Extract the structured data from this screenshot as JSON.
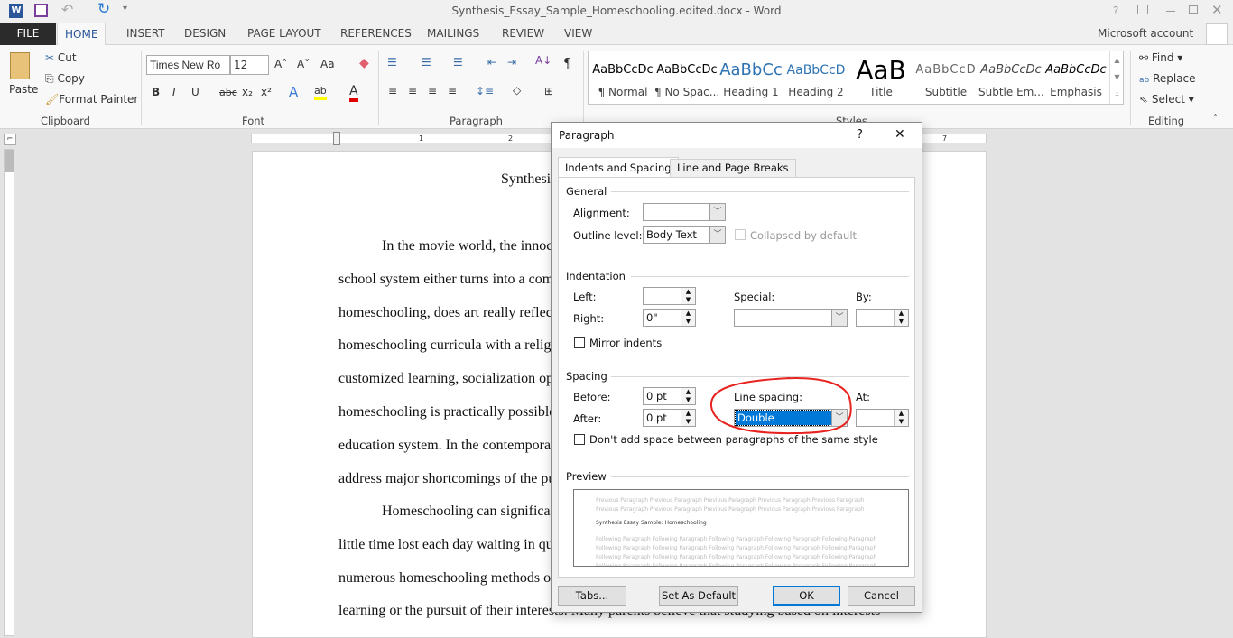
{
  "app": {
    "title": "Synthesis_Essay_Sample_Homeschooling.edited.docx - Word",
    "account": "Microsoft account",
    "help": "?"
  },
  "tabs": [
    "FILE",
    "HOME",
    "INSERT",
    "DESIGN",
    "PAGE LAYOUT",
    "REFERENCES",
    "MAILINGS",
    "REVIEW",
    "VIEW"
  ],
  "clipboard": {
    "paste": "Paste",
    "cut": "Cut",
    "copy": "Copy",
    "format_painter": "Format Painter",
    "label": "Clipboard"
  },
  "font": {
    "name": "Times New Ro",
    "size": "12",
    "label": "Font",
    "bold": "B",
    "italic": "I",
    "underline": "U",
    "strike": "abc",
    "sub": "x₂",
    "sup": "x²",
    "grow": "A˄",
    "shrink": "A˅",
    "case": "Aa"
  },
  "paragraph": {
    "label": "Paragraph",
    "pilcrow": "¶"
  },
  "styles": {
    "label": "Styles",
    "items": [
      {
        "preview": "AaBbCcDc",
        "name": "¶ Normal"
      },
      {
        "preview": "AaBbCcDc",
        "name": "¶ No Spac..."
      },
      {
        "preview": "AaBbCc",
        "name": "Heading 1"
      },
      {
        "preview": "AaBbCcD",
        "name": "Heading 2"
      },
      {
        "preview": "AaB",
        "name": "Title"
      },
      {
        "preview": "AaBbCcD",
        "name": "Subtitle"
      },
      {
        "preview": "AaBbCcDc",
        "name": "Subtle Em..."
      },
      {
        "preview": "AaBbCcDc",
        "name": "Emphasis"
      }
    ]
  },
  "editing": {
    "label": "Editing",
    "find": "Find",
    "replace": "Replace",
    "select": "Select"
  },
  "ruler": {
    "marks": [
      "1",
      "2",
      "7"
    ]
  },
  "document": {
    "title": "Synthesi",
    "lines": [
      "In the movie world, the innoc",
      "school system either turns into a com",
      "homeschooling, does art really reflec",
      "homeschooling curricula with a relig",
      "customized learning, socialization op",
      "homeschooling is practically possible",
      "education system. In the contempora",
      "address major shortcomings of the pu",
      "Homeschooling can significa",
      "little time lost each day waiting in qu",
      "numerous homeschooling methods o",
      "learning or the pursuit of their interests. Many parents believe that studying based on interests"
    ]
  },
  "dialog": {
    "title": "Paragraph",
    "help": "?",
    "close": "✕",
    "tabs": [
      "Indents and Spacing",
      "Line and Page Breaks"
    ],
    "general": {
      "heading": "General",
      "alignment_label": "Alignment:",
      "alignment_value": "",
      "outline_label": "Outline level:",
      "outline_value": "Body Text",
      "collapsed_label": "Collapsed by default"
    },
    "indentation": {
      "heading": "Indentation",
      "left_label": "Left:",
      "left_value": "",
      "right_label": "Right:",
      "right_value": "0\"",
      "special_label": "Special:",
      "special_value": "",
      "by_label": "By:",
      "by_value": "",
      "mirror_label": "Mirror indents"
    },
    "spacing": {
      "heading": "Spacing",
      "before_label": "Before:",
      "before_value": "0 pt",
      "after_label": "After:",
      "after_value": "0 pt",
      "line_spacing_label": "Line spacing:",
      "line_spacing_value": "Double",
      "at_label": "At:",
      "at_value": "",
      "dont_add_label": "Don't add space between paragraphs of the same style"
    },
    "preview": {
      "heading": "Preview",
      "previous": "Previous Paragraph Previous Paragraph Previous Paragraph Previous Paragraph Previous Paragraph",
      "sample": "Synthesis Essay Sample: Homeschooling",
      "following": "Following Paragraph Following Paragraph Following Paragraph Following Paragraph Following Paragraph"
    },
    "buttons": {
      "tabs": "Tabs...",
      "set_default": "Set As Default",
      "ok": "OK",
      "cancel": "Cancel"
    }
  },
  "colors": {
    "accent": "#2b579a",
    "annotation": "#e8231f",
    "selection": "#0078d7"
  }
}
